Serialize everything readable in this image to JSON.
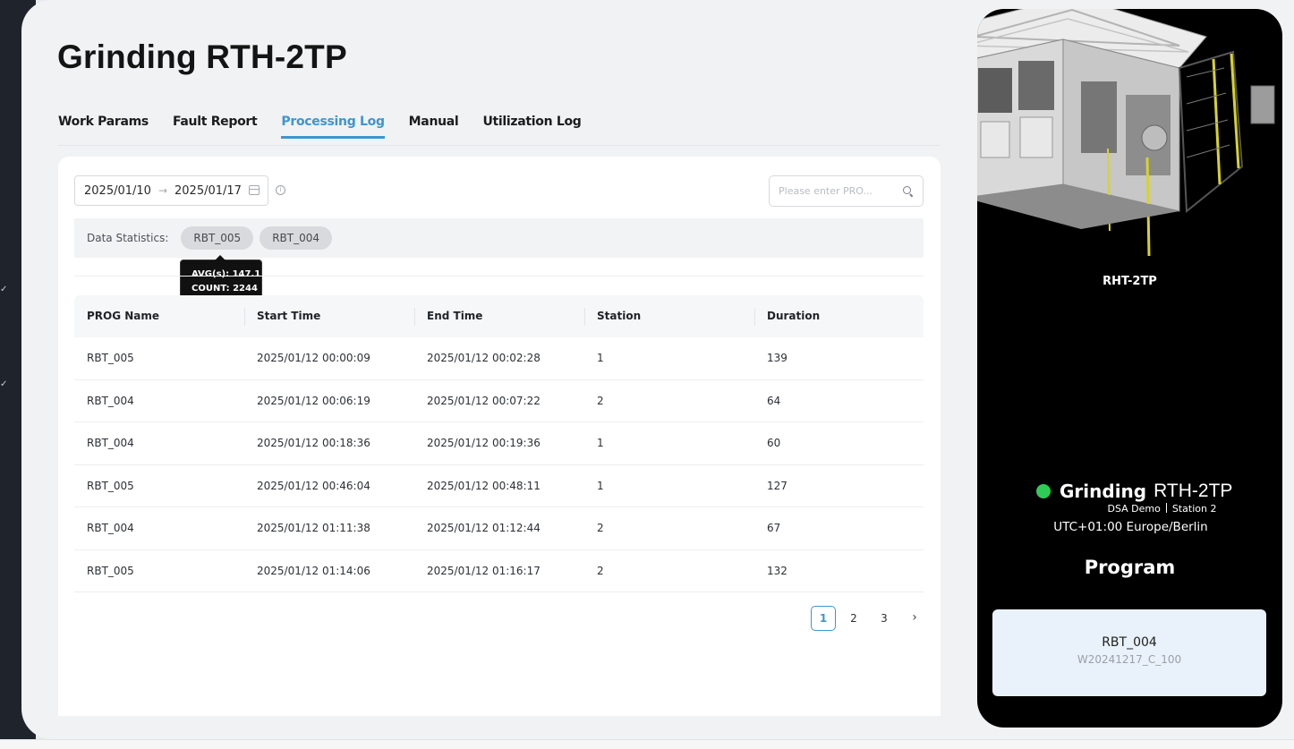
{
  "page": {
    "title": "Grinding RTH-2TP"
  },
  "tabs": [
    {
      "label": "Work Params",
      "active": false
    },
    {
      "label": "Fault Report",
      "active": false
    },
    {
      "label": "Processing Log",
      "active": true
    },
    {
      "label": "Manual",
      "active": false
    },
    {
      "label": "Utilization Log",
      "active": false
    }
  ],
  "filters": {
    "date_start": "2025/01/10",
    "date_end": "2025/01/17",
    "search_placeholder": "Please enter PRO..."
  },
  "stats": {
    "label": "Data Statistics:",
    "chips": [
      "RBT_005",
      "RBT_004"
    ],
    "tooltip": {
      "avg": "AVG(s): 147.1",
      "count": "COUNT: 2244"
    }
  },
  "table": {
    "headers": [
      "PROG Name",
      "Start Time",
      "End Time",
      "Station",
      "Duration"
    ],
    "rows": [
      [
        "RBT_005",
        "2025/01/12 00:00:09",
        "2025/01/12 00:02:28",
        "1",
        "139"
      ],
      [
        "RBT_004",
        "2025/01/12 00:06:19",
        "2025/01/12 00:07:22",
        "2",
        "64"
      ],
      [
        "RBT_004",
        "2025/01/12 00:18:36",
        "2025/01/12 00:19:36",
        "1",
        "60"
      ],
      [
        "RBT_005",
        "2025/01/12 00:46:04",
        "2025/01/12 00:48:11",
        "1",
        "127"
      ],
      [
        "RBT_004",
        "2025/01/12 01:11:38",
        "2025/01/12 01:12:44",
        "2",
        "67"
      ],
      [
        "RBT_005",
        "2025/01/12 01:14:06",
        "2025/01/12 01:16:17",
        "2",
        "132"
      ]
    ]
  },
  "pagination": {
    "pages": [
      "1",
      "2",
      "3"
    ],
    "current": "1",
    "next_icon": "chevron-right-icon"
  },
  "machine_panel": {
    "caption": "RHT-2TP",
    "status_color": "#2ecc57",
    "status_word": "Grinding",
    "status_model": "RTH-2TP",
    "site": "DSA Demo",
    "station": "Station 2",
    "timezone": "UTC+01:00 Europe/Berlin",
    "program_heading": "Program",
    "program_name": "RBT_004",
    "program_id": "W20241217_C_100"
  },
  "theme": {
    "accent": "#3d96cf"
  }
}
